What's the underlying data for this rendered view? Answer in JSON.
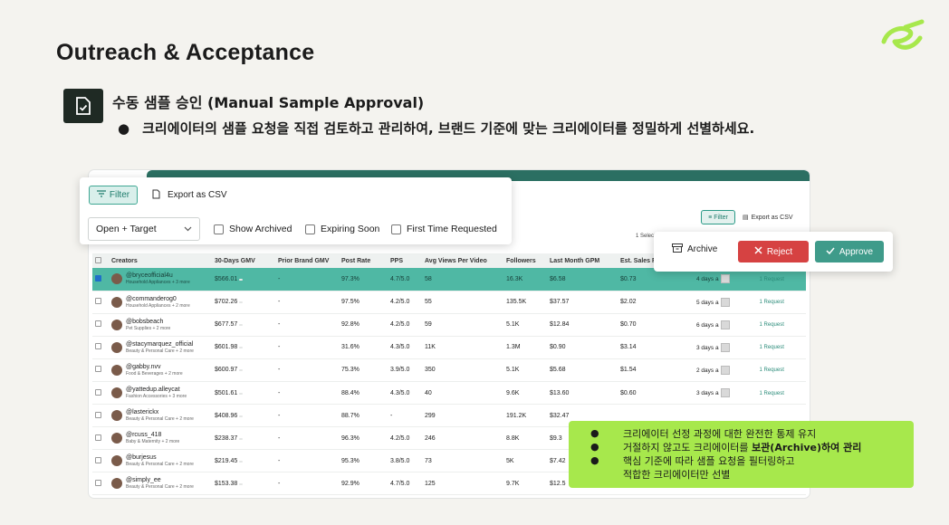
{
  "header": {
    "title": "Outreach & Acceptance"
  },
  "section": {
    "title": "수동 샘플 승인 (Manual Sample Approval)",
    "bullet": "크리에이터의 샘플 요청을 직접 검토하고 관리하여, 브랜드 기준에 맞는 크리에이터를 정밀하게 선별하세요."
  },
  "app": {
    "mini_filter_label": "Filter",
    "mini_export_label": "Export as CSV",
    "mini_select_text": "1 Select",
    "columns": [
      "Creators",
      "30-Days GMV",
      "Prior Brand GMV",
      "Post Rate",
      "PPS",
      "Avg Views Per Video",
      "Followers",
      "Last Month GPM",
      "Est. Sales F"
    ],
    "rows": [
      {
        "handle": "@bryceofficial4u",
        "sub": "Household Appliances + 3 more",
        "gmv": "$566.01",
        "prior": "-",
        "post": "97.3%",
        "pps": "4.7/5.0",
        "views": "58",
        "followers": "16.3K",
        "gpm": "$6.58",
        "sales": "$0.73",
        "days": "4 days a",
        "selected": true
      },
      {
        "handle": "@commanderog0",
        "sub": "Household Appliances + 2 more",
        "gmv": "$702.26",
        "prior": "-",
        "post": "97.5%",
        "pps": "4.2/5.0",
        "views": "55",
        "followers": "135.5K",
        "gpm": "$37.57",
        "sales": "$2.02",
        "days": "5 days a",
        "selected": false
      },
      {
        "handle": "@bobsbeach",
        "sub": "Pet Supplies + 2 more",
        "gmv": "$677.57",
        "prior": "-",
        "post": "92.8%",
        "pps": "4.2/5.0",
        "views": "59",
        "followers": "5.1K",
        "gpm": "$12.84",
        "sales": "$0.70",
        "days": "6 days a",
        "selected": false
      },
      {
        "handle": "@stacymarquez_official",
        "sub": "Beauty & Personal Care + 2 more",
        "gmv": "$601.98",
        "prior": "-",
        "post": "31.6%",
        "pps": "4.3/5.0",
        "views": "11K",
        "followers": "1.3M",
        "gpm": "$0.90",
        "sales": "$3.14",
        "days": "3 days a",
        "selected": false
      },
      {
        "handle": "@gabby.nvv",
        "sub": "Food & Beverages + 2 more",
        "gmv": "$600.97",
        "prior": "-",
        "post": "75.3%",
        "pps": "3.9/5.0",
        "views": "350",
        "followers": "5.1K",
        "gpm": "$5.68",
        "sales": "$1.54",
        "days": "2 days a",
        "selected": false
      },
      {
        "handle": "@yattedup.alleycat",
        "sub": "Fashion Accessories + 3 more",
        "gmv": "$501.61",
        "prior": "-",
        "post": "88.4%",
        "pps": "4.3/5.0",
        "views": "40",
        "followers": "9.6K",
        "gpm": "$13.60",
        "sales": "$0.60",
        "days": "3 days a",
        "selected": false
      },
      {
        "handle": "@lasterickx",
        "sub": "Beauty & Personal Care + 2 more",
        "gmv": "$408.96",
        "prior": "-",
        "post": "88.7%",
        "pps": "-",
        "views": "299",
        "followers": "191.2K",
        "gpm": "$32.47",
        "sales": "",
        "days": "",
        "selected": false
      },
      {
        "handle": "@rcuss_418",
        "sub": "Baby & Maternity + 2 more",
        "gmv": "$238.37",
        "prior": "-",
        "post": "96.3%",
        "pps": "4.2/5.0",
        "views": "246",
        "followers": "8.8K",
        "gpm": "$9.3",
        "sales": "",
        "days": "",
        "selected": false
      },
      {
        "handle": "@burjesus",
        "sub": "Beauty & Personal Care + 2 more",
        "gmv": "$219.45",
        "prior": "-",
        "post": "95.3%",
        "pps": "3.8/5.0",
        "views": "73",
        "followers": "5K",
        "gpm": "$7.42",
        "sales": "",
        "days": "",
        "selected": false
      },
      {
        "handle": "@simply_ee",
        "sub": "Beauty & Personal Care + 2 more",
        "gmv": "$153.38",
        "prior": "-",
        "post": "92.9%",
        "pps": "4.7/5.0",
        "views": "125",
        "followers": "9.7K",
        "gpm": "$12.5",
        "sales": "",
        "days": "",
        "selected": false
      }
    ],
    "request_label": "1 Request"
  },
  "filter_popup": {
    "filter_label": "Filter",
    "export_label": "Export as CSV",
    "dropdown_value": "Open + Target",
    "checkboxes": [
      "Show Archived",
      "Expiring Soon",
      "First Time Requested"
    ]
  },
  "action_popup": {
    "archive_label": "Archive",
    "reject_label": "Reject",
    "approve_label": "Approve"
  },
  "callout": {
    "line1": "크리에이터 선정 과정에 대한 완전한 통제 유지",
    "line2_pre": "거절하지 않고도 크리에이터를 ",
    "line2_bold": "보관(Archive)하여 관리",
    "line3": "핵심 기준에 따라 샘플 요청을 필터링하고",
    "line4": "적합한 크리에이터만 선별"
  },
  "colors": {
    "accent": "#3f9b8a",
    "reject": "#d64242",
    "callout": "#a7e84c",
    "logo": "#a7e84c"
  }
}
